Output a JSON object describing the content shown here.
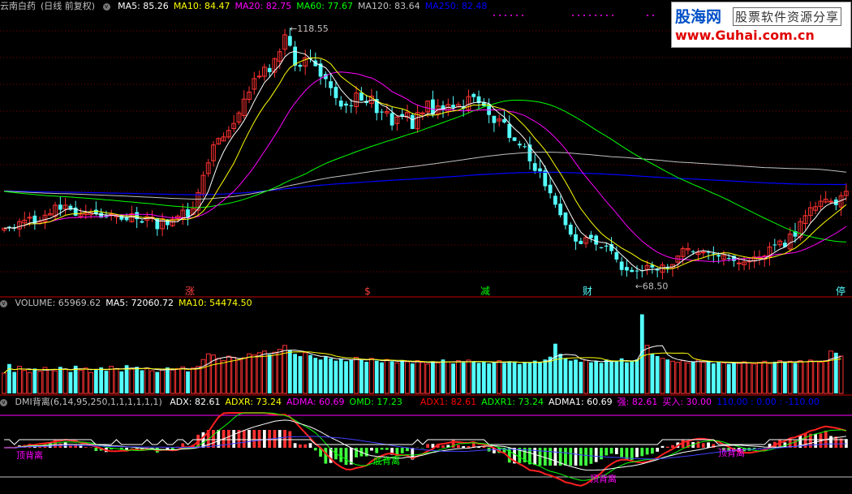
{
  "stock": {
    "name": "云南白药",
    "period": "(日线 前复权)"
  },
  "price_header": [
    {
      "label": "MA5:",
      "value": "85.26",
      "color": "#ffffff"
    },
    {
      "label": "MA10:",
      "value": "84.47",
      "color": "#ffff00"
    },
    {
      "label": "MA20:",
      "value": "82.75",
      "color": "#ff00ff"
    },
    {
      "label": "MA60:",
      "value": "77.67",
      "color": "#00ff00"
    },
    {
      "label": "MA120:",
      "value": "83.64",
      "color": "#c0c0c0"
    },
    {
      "label": "MA250:",
      "value": "82.48",
      "color": "#0000ff"
    }
  ],
  "volume_header": [
    {
      "label": "VOLUME:",
      "value": "65969.62",
      "color": "#c0c0c0"
    },
    {
      "label": "MA5:",
      "value": "72060.72",
      "color": "#ffffff"
    },
    {
      "label": "MA10:",
      "value": "54474.50",
      "color": "#ffff00"
    }
  ],
  "dmi_header": {
    "title": "DMI背离(6,14,95,250,1,1,1,1,1,1)",
    "items": [
      {
        "label": "ADX:",
        "value": "82.61",
        "color": "#ffffff"
      },
      {
        "label": "ADXR:",
        "value": "73.24",
        "color": "#ffff00"
      },
      {
        "label": "ADMA:",
        "value": "60.69",
        "color": "#ff00ff"
      },
      {
        "label": "OMD:",
        "value": "17.23",
        "color": "#00ff00"
      }
    ],
    "items2": [
      {
        "label": "ADX1:",
        "value": "82.61",
        "color": "#ff0000"
      },
      {
        "label": "ADXR1:",
        "value": "73.24",
        "color": "#00ff00"
      },
      {
        "label": "ADMA1:",
        "value": "60.69",
        "color": "#ffffff"
      },
      {
        "label": "强:",
        "value": "82.61",
        "color": "#ff00ff"
      },
      {
        "label": "买入:",
        "value": "30.00",
        "color": "#ff00ff"
      },
      {
        "label": "110.00",
        "value": ": 0.00 : -110.00",
        "color": "#0000ff"
      }
    ]
  },
  "logo": {
    "site": "股海网",
    "tagline": "股票软件资源分享",
    "url": "www.Guhai.com.cn"
  },
  "colors": {
    "up": "#ff3232",
    "down": "#54ffff",
    "ma5": "#ffffff",
    "ma10": "#ffff00",
    "ma20": "#ff00ff",
    "ma60": "#00ff00",
    "ma120": "#c0c0c0",
    "ma250": "#0000ff",
    "axis": "#c00000"
  },
  "chart_data": [
    {
      "type": "candlestick",
      "title": "云南白药 (日线 前复权)",
      "ylim": [
        66,
        122
      ],
      "close": [
        78.5,
        78.6,
        78.4,
        79.8,
        80.1,
        80.7,
        79.4,
        79.8,
        81.1,
        81.4,
        83.1,
        82.2,
        83.1,
        82.2,
        81.0,
        81.3,
        81.5,
        81.6,
        81.3,
        80.6,
        80.7,
        81.3,
        81.0,
        80.2,
        80.1,
        81.4,
        80.3,
        79.6,
        80.8,
        80.7,
        78.3,
        80.4,
        79.1,
        80.3,
        80.9,
        82.1,
        80.7,
        82.4,
        85.6,
        89.1,
        91.6,
        95.2,
        96.5,
        96.8,
        98.1,
        99.5,
        101.6,
        104.4,
        105.8,
        108.5,
        109.0,
        110.8,
        109.8,
        112.5,
        113.9,
        117.3,
        115.1,
        111.1,
        110.9,
        112.7,
        112.4,
        111.0,
        108.9,
        108.4,
        106.6,
        104.6,
        102.9,
        103.1,
        103.0,
        105.6,
        104.1,
        103.6,
        105.0,
        101.6,
        101.8,
        101.9,
        99.1,
        100.8,
        101.0,
        101.7,
        98.4,
        101.7,
        101.6,
        104.0,
        101.3,
        103.0,
        102.3,
        103.3,
        102.7,
        103.3,
        102.5,
        104.9,
        104.8,
        103.6,
        103.0,
        101.2,
        99.6,
        100.4,
        99.7,
        96.6,
        96.0,
        95.1,
        94.8,
        91.9,
        90.0,
        89.9,
        86.9,
        85.5,
        83.2,
        81.1,
        79.1,
        77.2,
        75.8,
        75.3,
        76.6,
        76.5,
        75.2,
        74.6,
        74.8,
        73.9,
        72.2,
        70.1,
        70.0,
        69.7,
        69.9,
        69.9,
        71.0,
        70.6,
        70.0,
        71.1,
        70.6,
        71.2,
        72.9,
        74.4,
        74.4,
        73.8,
        73.6,
        73.7,
        73.6,
        73.3,
        72.8,
        73.0,
        72.4,
        71.9,
        71.5,
        71.7,
        71.9,
        72.7,
        72.7,
        72.9,
        74.7,
        75.2,
        75.9,
        74.7,
        77.3,
        76.8,
        79.8,
        81.0,
        82.6,
        82.8,
        83.9,
        84.3,
        83.9,
        83.1,
        85.0,
        85.9
      ],
      "volume": [
        36000,
        52000,
        38000,
        48000,
        41000,
        37000,
        44000,
        39000,
        46000,
        42000,
        40000,
        47000,
        43000,
        38000,
        49000,
        41000,
        45000,
        37000,
        42000,
        46000,
        40000,
        48000,
        44000,
        39000,
        50000,
        43000,
        47000,
        41000,
        45000,
        40000,
        38000,
        43000,
        46000,
        42000,
        44000,
        47000,
        39000,
        45000,
        48000,
        60000,
        70000,
        68000,
        62000,
        58000,
        66000,
        64000,
        59000,
        63000,
        70000,
        68000,
        72000,
        75000,
        69000,
        73000,
        78000,
        85000,
        77000,
        70000,
        66000,
        72000,
        68000,
        63000,
        60000,
        65000,
        62000,
        58000,
        61000,
        57000,
        60000,
        64000,
        59000,
        56000,
        62000,
        58000,
        55000,
        60000,
        57000,
        54000,
        59000,
        56000,
        53000,
        58000,
        55000,
        52000,
        57000,
        54000,
        60000,
        56000,
        53000,
        58000,
        55000,
        59000,
        57000,
        54000,
        56000,
        53000,
        55000,
        58000,
        54000,
        57000,
        55000,
        52000,
        56000,
        54000,
        58000,
        55000,
        60000,
        65000,
        88000,
        70000,
        62000,
        58000,
        60000,
        56000,
        59000,
        55000,
        57000,
        54000,
        60000,
        56000,
        58000,
        62000,
        55000,
        57000,
        60000,
        140000,
        85000,
        70000,
        66000,
        62000,
        60000,
        57000,
        55000,
        58000,
        54000,
        56000,
        59000,
        55000,
        57000,
        53000,
        56000,
        54000,
        52000,
        55000,
        53000,
        56000,
        54000,
        52000,
        55000,
        57000,
        53000,
        56000,
        58000,
        55000,
        57000,
        54000,
        58000,
        56000,
        59000,
        57000,
        55000,
        58000,
        75000,
        72000,
        66000
      ]
    }
  ],
  "annotations": {
    "high_label": "118.55",
    "low_label": "68.50",
    "signals": [
      {
        "text": "涨",
        "color": "#ff4040"
      },
      {
        "text": "$",
        "color": "#ff4040"
      },
      {
        "text": "减",
        "color": "#00ff00"
      },
      {
        "text": "财",
        "color": "#54ffff"
      },
      {
        "text": "停",
        "color": "#54ffff"
      }
    ],
    "divergences": [
      {
        "text": "顶背离",
        "color": "#ff00ff"
      },
      {
        "text": "底背离",
        "color": "#00ff00"
      },
      {
        "text": "顶背离",
        "color": "#ff00ff"
      },
      {
        "text": "顶背离",
        "color": "#ff00ff"
      }
    ]
  }
}
